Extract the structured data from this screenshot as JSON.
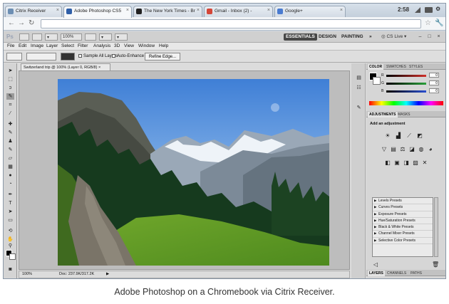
{
  "browser": {
    "tabs": [
      {
        "label": "Citrix Receiver",
        "favicon_color": "#6d8fb3"
      },
      {
        "label": "Adobe Photoshop CS5",
        "favicon_color": "#2f5fa8"
      },
      {
        "label": "The New York Times - Br",
        "favicon_color": "#222222"
      },
      {
        "label": "Gmail - Inbox (2) -",
        "favicon_color": "#d44638"
      },
      {
        "label": "Google+",
        "favicon_color": "#4a7bd0"
      }
    ],
    "active_tab_index": 1,
    "clock": "2:58",
    "address": ""
  },
  "photoshop": {
    "logo": "Ps",
    "zoom_control": "100%",
    "workspaces": [
      "ESSENTIALS",
      "DESIGN",
      "PAINTING"
    ],
    "active_workspace": "ESSENTIALS",
    "workspaces_more": "»",
    "cs_live": "CS Live",
    "menus": [
      "File",
      "Edit",
      "Image",
      "Layer",
      "Select",
      "Filter",
      "Analysis",
      "3D",
      "View",
      "Window",
      "Help"
    ],
    "options": {
      "sample_all_layers": "Sample All Layers",
      "auto_enhance": "Auto-Enhance",
      "refine_edge": "Refine Edge..."
    },
    "document_tab": "Switzerland trip @ 100% (Layer 0, RGB/8)",
    "status": {
      "zoom": "100%",
      "doc": "Doc: 237.9K/317.2K"
    },
    "color_panel": {
      "tabs": [
        "COLOR",
        "SWATCHES",
        "STYLES"
      ],
      "channels": [
        {
          "label": "R",
          "value": "0",
          "color": "#d0302a"
        },
        {
          "label": "G",
          "value": "0",
          "color": "#2aa03a"
        },
        {
          "label": "B",
          "value": "0",
          "color": "#2a4fd0"
        }
      ]
    },
    "adjustments_panel": {
      "tabs": [
        "ADJUSTMENTS",
        "MASKS"
      ],
      "heading": "Add an adjustment",
      "presets": [
        "Levels Presets",
        "Curves Presets",
        "Exposure Presets",
        "Hue/Saturation Presets",
        "Black & White Presets",
        "Channel Mixer Presets",
        "Selective Color Presets"
      ]
    },
    "layers_panel": {
      "tabs": [
        "LAYERS",
        "CHANNELS",
        "PATHS"
      ]
    }
  },
  "caption": "Adobe Photoshop on a Chromebook via Citrix Receiver."
}
